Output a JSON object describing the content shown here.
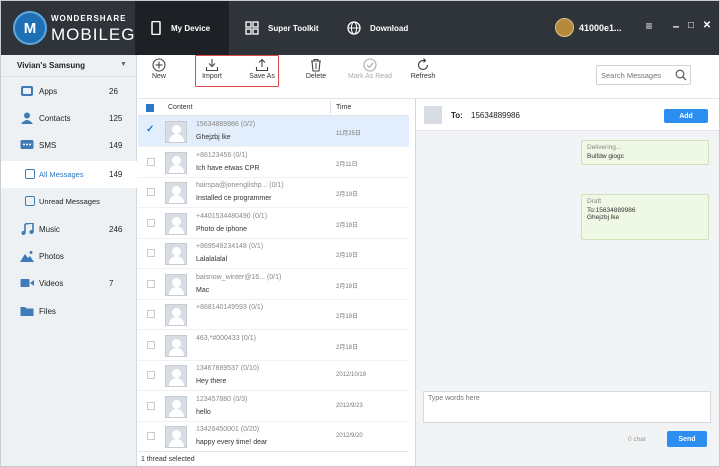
{
  "app": {
    "brand_top": "WONDERSHARE",
    "brand_main": "MOBILEGO",
    "logo_letter": "M"
  },
  "nav": {
    "tabs": [
      {
        "label": "My Device",
        "icon": "phone-icon",
        "active": true
      },
      {
        "label": "Super Toolkit",
        "icon": "grid-icon",
        "active": false
      },
      {
        "label": "Download",
        "icon": "globe-icon",
        "active": false
      }
    ],
    "user": "41000e1..."
  },
  "window": {
    "menu": "≡",
    "minimize": "–",
    "maximize": "□",
    "close": "✕"
  },
  "sidebar": {
    "device": "Vivian's Samsung",
    "items": [
      {
        "label": "Apps",
        "count": "26",
        "icon": "apps-icon"
      },
      {
        "label": "Contacts",
        "count": "125",
        "icon": "contacts-icon"
      },
      {
        "label": "SMS",
        "count": "149",
        "icon": "sms-icon"
      },
      {
        "label": "All Messages",
        "count": "149",
        "icon": "message-icon",
        "active": true
      },
      {
        "label": "Unread Messages",
        "count": "",
        "icon": "message-icon"
      },
      {
        "label": "Music",
        "count": "246",
        "icon": "music-icon"
      },
      {
        "label": "Photos",
        "count": "",
        "icon": "photos-icon"
      },
      {
        "label": "Videos",
        "count": "7",
        "icon": "videos-icon"
      },
      {
        "label": "Files",
        "count": "",
        "icon": "folder-icon"
      }
    ]
  },
  "toolbar": {
    "new": "New",
    "import": "Import",
    "save_as": "Save As",
    "delete": "Delete",
    "mark_read": "Mark As Read",
    "refresh": "Refresh",
    "search_placeholder": "Search Messages"
  },
  "list": {
    "col_content": "Content",
    "col_time": "Time",
    "rows": [
      {
        "phone": "15634889986   (0/2)",
        "body": "Ghejzbj lke",
        "time": "11月25日",
        "selected": true
      },
      {
        "phone": "+86123456   (0/1)",
        "body": "Ich have etwas CPR",
        "time": "2月11日"
      },
      {
        "phone": "hairspa@jonenglishp...   (0/1)",
        "body": "Installed ce programmer",
        "time": "2月19日"
      },
      {
        "phone": "+4401534480490   (0/1)",
        "body": "Photo de iphone",
        "time": "2月19日"
      },
      {
        "phone": "+869549234148   (0/1)",
        "body": "Lalalalalal",
        "time": "2月19日"
      },
      {
        "phone": "baisnow_winter@16...   (0/1)",
        "body": "Mac",
        "time": "2月19日"
      },
      {
        "phone": "+868140149593   (0/1)",
        "body": "",
        "time": "2月19日"
      },
      {
        "phone": "463,*#000433   (0/1)",
        "body": "",
        "time": "2月18日"
      },
      {
        "phone": "13467889537   (0/10)",
        "body": "Hey there",
        "time": "2012/10/18"
      },
      {
        "phone": "123457880   (0/3)",
        "body": "hello",
        "time": "2012/9/23"
      },
      {
        "phone": "13426450001   (0/20)",
        "body": "happy every time! dear",
        "time": "2012/9/20"
      }
    ],
    "status": "1 thread selected"
  },
  "chat": {
    "to_label": "To:",
    "number": "15634889986",
    "add": "Add",
    "messages": [
      {
        "status": "Delivering...",
        "text": "Buifdw giogc"
      },
      {
        "status": "Draft",
        "text": "To:15634889986",
        "text2": "Ghejzbj lke"
      }
    ],
    "placeholder": "Type words here",
    "char_count": "0 char",
    "send": "Send"
  },
  "colors": {
    "topbar": "#2f343a",
    "accent": "#2c8ef0",
    "highlight_box": "#e24a4a",
    "selected_row": "#e2eefb"
  }
}
